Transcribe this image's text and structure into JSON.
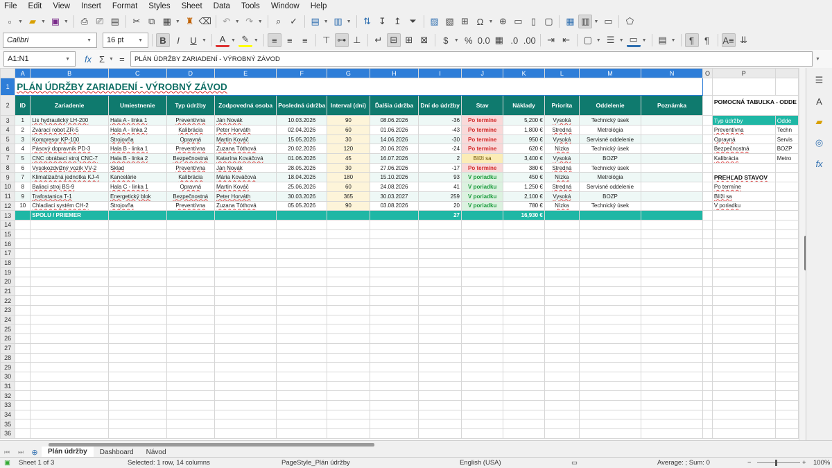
{
  "menu": [
    "File",
    "Edit",
    "View",
    "Insert",
    "Format",
    "Styles",
    "Sheet",
    "Data",
    "Tools",
    "Window",
    "Help"
  ],
  "toolbar": {
    "font_name": "Calibri",
    "font_size": "16 pt"
  },
  "formula_bar": {
    "name_box": "A1:N1",
    "sum_symbol": "Σ",
    "equals": "=",
    "content": "PLÁN ÚDRŽBY ZARIADENÍ - VÝROBNÝ ZÁVOD"
  },
  "columns": [
    "A",
    "B",
    "C",
    "D",
    "E",
    "F",
    "G",
    "H",
    "I",
    "J",
    "K",
    "L",
    "M",
    "N",
    "O",
    "P",
    ""
  ],
  "title": "PLÁN ÚDRŽBY ZARIADENÍ - VÝROBNÝ ZÁVOD",
  "headers": [
    "ID",
    "Zariadenie",
    "Umiestnenie",
    "Typ údržby",
    "Zodpovedná osoba",
    "Posledná údržba",
    "Interval (dni)",
    "Ďalšia údržba",
    "Dní do údržby",
    "Stav",
    "Náklady",
    "Priorita",
    "Oddelenie",
    "Poznámka"
  ],
  "rows": [
    {
      "id": "1",
      "device": "Lis hydraulický LH-200",
      "location": "Hala A - linka 1",
      "type": "Preventívna",
      "person": "Ján Novák",
      "last": "10.03.2026",
      "interval": "90",
      "next": "08.06.2026",
      "days": "-36",
      "status": "Po termíne",
      "cost": "5,200 €",
      "priority": "Vysoká",
      "dept": "Technický úsek",
      "note": ""
    },
    {
      "id": "2",
      "device": "Zvárací robot ZR-5",
      "location": "Hala A - linka 2",
      "type": "Kalibrácia",
      "person": "Peter Horváth",
      "last": "02.04.2026",
      "interval": "60",
      "next": "01.06.2026",
      "days": "-43",
      "status": "Po termíne",
      "cost": "1,800 €",
      "priority": "Stredná",
      "dept": "Metrológia",
      "note": ""
    },
    {
      "id": "3",
      "device": "Kompresor KP-100",
      "location": "Strojovňa",
      "type": "Opravná",
      "person": "Martin Kováč",
      "last": "15.05.2026",
      "interval": "30",
      "next": "14.06.2026",
      "days": "-30",
      "status": "Po termíne",
      "cost": "950 €",
      "priority": "Vysoká",
      "dept": "Servisné oddelenie",
      "note": ""
    },
    {
      "id": "4",
      "device": "Pásový dopravník PD-3",
      "location": "Hala B - linka 1",
      "type": "Preventívna",
      "person": "Zuzana Tóthová",
      "last": "20.02.2026",
      "interval": "120",
      "next": "20.06.2026",
      "days": "-24",
      "status": "Po termíne",
      "cost": "620 €",
      "priority": "Nízka",
      "dept": "Technický úsek",
      "note": ""
    },
    {
      "id": "5",
      "device": "CNC obrábací stroj CNC-7",
      "location": "Hala B - linka 2",
      "type": "Bezpečnostná",
      "person": "Katarína Kováčová",
      "last": "01.06.2026",
      "interval": "45",
      "next": "16.07.2026",
      "days": "2",
      "status": "Blíži sa",
      "cost": "3,400 €",
      "priority": "Vysoká",
      "dept": "BOZP",
      "note": ""
    },
    {
      "id": "6",
      "device": "Vysokozdvižný vozík VV-2",
      "location": "Sklad",
      "type": "Preventívna",
      "person": "Ján Novák",
      "last": "28.05.2026",
      "interval": "30",
      "next": "27.06.2026",
      "days": "-17",
      "status": "Po termíne",
      "cost": "380 €",
      "priority": "Stredná",
      "dept": "Technický úsek",
      "note": ""
    },
    {
      "id": "7",
      "device": "Klimatizačná jednotka KJ-4",
      "location": "Kancelárie",
      "type": "Kalibrácia",
      "person": "Mária Kováčová",
      "last": "18.04.2026",
      "interval": "180",
      "next": "15.10.2026",
      "days": "93",
      "status": "V poriadku",
      "cost": "450 €",
      "priority": "Nízka",
      "dept": "Metrológia",
      "note": ""
    },
    {
      "id": "8",
      "device": "Baliaci stroj BS-9",
      "location": "Hala C - linka 1",
      "type": "Opravná",
      "person": "Martin Kováč",
      "last": "25.06.2026",
      "interval": "60",
      "next": "24.08.2026",
      "days": "41",
      "status": "V poriadku",
      "cost": "1,250 €",
      "priority": "Stredná",
      "dept": "Servisné oddelenie",
      "note": ""
    },
    {
      "id": "9",
      "device": "Trafostanica T-1",
      "location": "Energetický blok",
      "type": "Bezpečnostná",
      "person": "Peter Horváth",
      "last": "30.03.2026",
      "interval": "365",
      "next": "30.03.2027",
      "days": "259",
      "status": "V poriadku",
      "cost": "2,100 €",
      "priority": "Vysoká",
      "dept": "BOZP",
      "note": ""
    },
    {
      "id": "10",
      "device": "Chladiaci systém CH-2",
      "location": "Strojovňa",
      "type": "Preventívna",
      "person": "Zuzana Tóthová",
      "last": "05.05.2026",
      "interval": "90",
      "next": "03.08.2026",
      "days": "20",
      "status": "V poriadku",
      "cost": "780 €",
      "priority": "Nízka",
      "dept": "Technický úsek",
      "note": ""
    }
  ],
  "totals": {
    "label": "SPOLU / PRIEMER",
    "days": "27",
    "cost": "16,930 €"
  },
  "side": {
    "title": "POMOCNÁ TABUĽKA - ODDE",
    "hdr_p": "Typ údržby",
    "hdr_q": "Odde",
    "rows": [
      [
        "Preventívna",
        "Techn"
      ],
      [
        "Opravná",
        "Servis"
      ],
      [
        "Bezpečnostná",
        "BOZP"
      ],
      [
        "Kalibrácia",
        "Metro"
      ]
    ],
    "status_title": "PREHĽAD STAVOV",
    "status": [
      "Po termíne",
      "Blíži sa",
      "V poriadku"
    ]
  },
  "sheet_tabs": [
    "Plán údržby",
    "Dashboard",
    "Návod"
  ],
  "status": {
    "sheet": "Sheet 1 of 3",
    "selection": "Selected: 1 row, 14 columns",
    "pagestyle": "PageStyle_Plán údržby",
    "lang": "English (USA)",
    "sum": "Average: ; Sum: 0",
    "zoom": "100%"
  },
  "colors": {
    "header": "#0f7a6e",
    "total": "#1fb7a5",
    "selection": "#2f7ed8",
    "late": "#d12b2b",
    "ok": "#1a9a3b"
  }
}
